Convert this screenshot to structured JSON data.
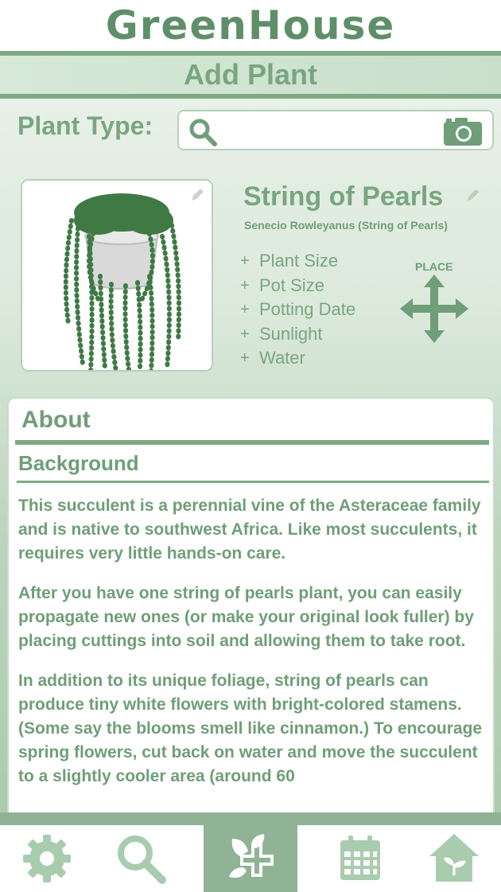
{
  "app": {
    "logo": "GreenHouse"
  },
  "header": {
    "title": "Add Plant"
  },
  "search": {
    "label": "Plant Type:",
    "value": "",
    "placeholder": ""
  },
  "plant": {
    "name": "String of Pearls",
    "scientific": "Senecio Rowleyanus (String of Pearls)",
    "properties": [
      {
        "label": "Plant Size"
      },
      {
        "label": "Pot Size"
      },
      {
        "label": "Potting Date"
      },
      {
        "label": "Sunlight"
      },
      {
        "label": "Water"
      }
    ],
    "place_label": "PLACE"
  },
  "about": {
    "title": "About",
    "section_title": "Background",
    "paragraphs": [
      "This succulent is a perennial vine of the Asteraceae family and is native to southwest Africa. Like most succulents, it requires very little hands-on care.",
      "After you have one string of pearls plant, you can easily propagate new ones (or make your original look fuller) by placing cuttings into soil and allowing them to take root.",
      "In addition to its unique foliage, string of pearls can produce tiny white flowers with bright-colored stamens. (Some say the blooms smell like cinnamon.) To encourage spring flowers, cut back on water and move the succulent to a slightly cooler area (around 60"
    ]
  },
  "nav": {
    "items": [
      {
        "icon": "gear-icon",
        "active": false
      },
      {
        "icon": "search-icon",
        "active": false
      },
      {
        "icon": "plant-plus-icon",
        "active": true
      },
      {
        "icon": "calendar-icon",
        "active": false
      },
      {
        "icon": "home-icon",
        "active": false
      }
    ]
  },
  "colors": {
    "primary": "#79a681",
    "dark": "#5f8f69",
    "band": "#7fa985",
    "nav_active": "#8fb394"
  }
}
